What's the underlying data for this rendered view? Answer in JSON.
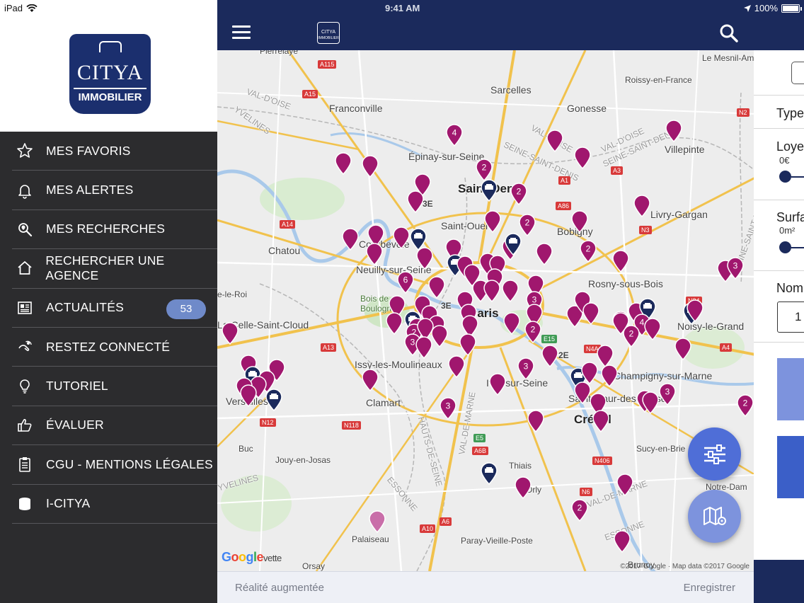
{
  "status_bar": {
    "device": "iPad",
    "time": "9:41 AM",
    "battery": "100%",
    "battery_level": 1.0
  },
  "brand": {
    "name": "CITYA",
    "sub": "IMMOBILIER",
    "navy": "#1b2a5c",
    "accent": "#4f6ed7",
    "pin_color": "#a0176e",
    "agency_pin_color": "#1b2a5c"
  },
  "menu": {
    "items": [
      {
        "label": "MES FAVORIS",
        "icon": "star-icon"
      },
      {
        "label": "MES ALERTES",
        "icon": "bell-icon"
      },
      {
        "label": "MES RECHERCHES",
        "icon": "search-location-icon"
      },
      {
        "label": "RECHERCHER UNE AGENCE",
        "icon": "home-icon"
      },
      {
        "label": "ACTUALITÉS",
        "icon": "newspaper-icon",
        "badge": "53"
      },
      {
        "label": "RESTEZ CONNECTÉ",
        "icon": "connect-icon"
      },
      {
        "label": "TUTORIEL",
        "icon": "lightbulb-icon"
      },
      {
        "label": "ÉVALUER",
        "icon": "thumbs-up-icon"
      },
      {
        "label": "CGU - MENTIONS LÉGALES",
        "icon": "clipboard-icon"
      },
      {
        "label": "I-CITYA",
        "icon": "database-icon"
      }
    ]
  },
  "top_bar": {
    "logo_text_1": "CITYA",
    "logo_text_2": "IMMOBILIER"
  },
  "map": {
    "labels": {
      "sarcelles": "Sarcelles",
      "franconville": "Franconville",
      "gonesse": "Gonesse",
      "roissy": "Roissy-en-France",
      "le_mesnil": "Le Mesnil-Am",
      "epinay": "Épinay-sur-Seine",
      "villepinte": "Villepinte",
      "saint_denis": "Saint-Denis",
      "saint_ouen": "Saint-Ouen",
      "bobigny": "Bobigny",
      "livry": "Livry-Gargan",
      "chatou": "Chatou",
      "courbevoie": "Courbevoie",
      "neuilly": "Neuilly-sur-Seine",
      "bois_boulogne": "Bois de\nBoulogne",
      "paris": "Paris",
      "rosny": "Rosny-sous-Bois",
      "noisy": "Noisy-le-Grand",
      "la_celle": "La Celle-Saint-Cloud",
      "ile_roi": "e-le-Roi",
      "issy": "Issy-les-Moulineaux",
      "champigny": "Champigny-sur-Marne",
      "ivry": "Ivry-sur-Seine",
      "saint_maur": "Saint-Maur-des-Fossés",
      "versailles": "Versailles",
      "clamart": "Clamart",
      "creteil": "Créteil",
      "buc": "Buc",
      "jouy": "Jouy-en-Josas",
      "sucy": "Sucy-en-Brie",
      "thiais": "Thiais",
      "orly": "Orly",
      "notre_dame": "Notre-Dam",
      "palaiseau": "Palaiseau",
      "paray": "Paray-Vieille-Poste",
      "orsay": "Orsay",
      "brunoy": "Brunoy",
      "pierrelaye": "Pierrelaye",
      "val_doise": "VAL-D'OISE",
      "seine_st_denis": "SEINE-SAINT-DENIS",
      "yvelines": "YVELINES",
      "hauts_de_seine": "HAUTS-DE-SEINE",
      "val_de_marne": "VAL-DE-MARNE",
      "essonne": "ESSONNE",
      "e2": "2E",
      "e3": "3E"
    },
    "road_shields": [
      "A115",
      "A15",
      "A1",
      "A3",
      "N2",
      "A86",
      "A14",
      "N3",
      "A13",
      "N13",
      "N34",
      "A4",
      "E15",
      "N4A",
      "N12",
      "N118",
      "E5",
      "A6B",
      "N406",
      "N6",
      "A10",
      "A6"
    ],
    "google_text": "Google",
    "google_trail": "vette",
    "copyright": "©2017 Google · Map data ©2017 Google",
    "pin_counts": [
      "4",
      "2",
      "2",
      "2",
      "3",
      "2",
      "6",
      "3",
      "2",
      "2",
      "4",
      "2",
      "3",
      "3",
      "3",
      "3",
      "2",
      "3",
      "2"
    ]
  },
  "bottom_bar": {
    "left": "Réalité augmentée",
    "right": "Enregistrer"
  },
  "filter_panel": {
    "type_label": "Type d",
    "loyer_label": "Loyer",
    "loyer_value": "0€",
    "surface_label": "Surfa",
    "surface_value": "0m²",
    "nombre_label": "Nomb",
    "nombre_value": "1"
  },
  "fabs": {
    "filter_icon": "sliders-icon",
    "map_settings_icon": "map-settings-icon"
  }
}
